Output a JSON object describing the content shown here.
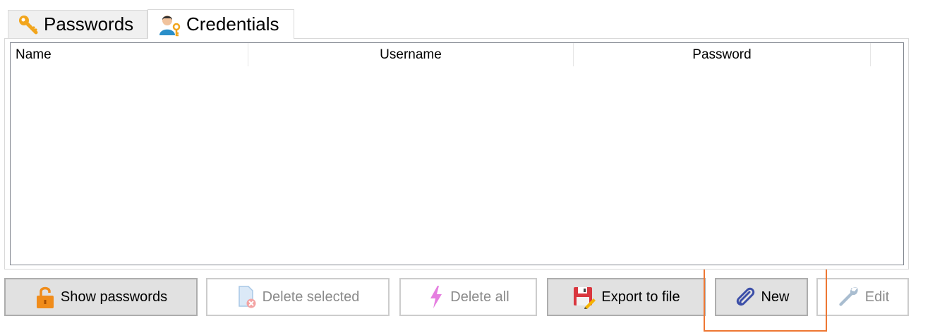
{
  "tabs": [
    {
      "label": "Passwords",
      "icon": "key-icon",
      "selected": false
    },
    {
      "label": "Credentials",
      "icon": "user-key-icon",
      "selected": true
    }
  ],
  "table": {
    "columns": [
      "Name",
      "Username",
      "Password"
    ],
    "rows": []
  },
  "buttons": {
    "show_passwords": {
      "label": "Show passwords",
      "icon": "padlock-open-icon",
      "enabled": true
    },
    "delete_selected": {
      "label": "Delete selected",
      "icon": "document-delete-icon",
      "enabled": false
    },
    "delete_all": {
      "label": "Delete all",
      "icon": "lightning-icon",
      "enabled": false
    },
    "export_to_file": {
      "label": "Export to file",
      "icon": "floppy-disk-pencil-icon",
      "enabled": true
    },
    "new": {
      "label": "New",
      "icon": "paperclip-icon",
      "enabled": true
    },
    "edit": {
      "label": "Edit",
      "icon": "wrench-icon",
      "enabled": false
    }
  },
  "colors": {
    "highlight": "#ee7733",
    "button_face": "#e1e1e1",
    "disabled_text": "#8a8a8a"
  }
}
